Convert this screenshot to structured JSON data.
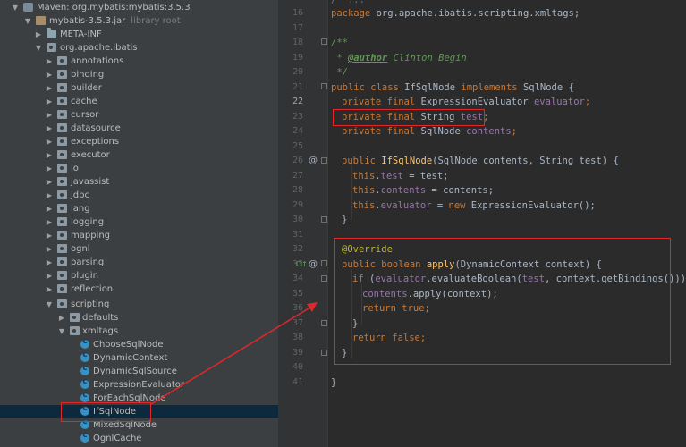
{
  "project_tree": {
    "maven_root": "Maven: org.mybatis:mybatis:3.5.3",
    "jar": {
      "name": "mybatis-3.5.3.jar",
      "suffix": "library root"
    },
    "meta_inf": "META-INF",
    "base_package": "org.apache.ibatis",
    "packages": [
      "annotations",
      "binding",
      "builder",
      "cache",
      "cursor",
      "datasource",
      "exceptions",
      "executor",
      "io",
      "javassist",
      "jdbc",
      "lang",
      "logging",
      "mapping",
      "ognl",
      "parsing",
      "plugin",
      "reflection"
    ],
    "scripting": "scripting",
    "defaults": "defaults",
    "xmltags": "xmltags",
    "classes": [
      "ChooseSqlNode",
      "DynamicContext",
      "DynamicSqlSource",
      "ExpressionEvaluator",
      "ForEachSqlNode",
      "IfSqlNode",
      "MixedSqlNode",
      "OgnlCache"
    ],
    "selected": "IfSqlNode"
  },
  "editor": {
    "line_numbers": [
      "16",
      "17",
      "18",
      "19",
      "20",
      "21",
      "22",
      "23",
      "24",
      "25",
      "26",
      "27",
      "28",
      "29",
      "30",
      "31",
      "32",
      "33",
      "34",
      "35",
      "36",
      "37",
      "38",
      "39",
      "40",
      "41"
    ],
    "gutter_marks": {
      "at_26": "@",
      "at_33": "@",
      "override_33": "O↑"
    },
    "code": {
      "l16_kw": "package",
      "l16_rest": " org.apache.ibatis.scripting.xmltags;",
      "l19": "/**",
      "l20_star": " * ",
      "l20_tag": "@author",
      "l20_name": " Clinton Begin",
      "l21": " */",
      "l21b_kw": "public class",
      "l21b_name": " IfSqlNode ",
      "l21b_kw2": "implements",
      "l21b_rest": " SqlNode {",
      "l22_kw": "private final",
      "l22_type": " ExpressionEvaluator ",
      "l22_field": "evaluator",
      "l22_end": ";",
      "l23_kw": "private final",
      "l23_type": " String ",
      "l23_field": "test",
      "l23_end": ";",
      "l24_kw": "private final",
      "l24_type": " SqlNode ",
      "l24_field": "contents",
      "l24_end": ";",
      "l26_kw": "public",
      "l26_fn": " IfSqlNode",
      "l26_rest": "(SqlNode contents, String test) {",
      "l27_kw": "this",
      "l27_dot": ".",
      "l27_field": "test",
      "l27_rest": " = test;",
      "l28_kw": "this",
      "l28_dot": ".",
      "l28_field": "contents",
      "l28_rest": " = contents;",
      "l29_kw": "this",
      "l29_dot": ".",
      "l29_field": "evaluator",
      "l29_mid": " = ",
      "l29_kw2": "new",
      "l29_rest": " ExpressionEvaluator();",
      "l30": "}",
      "l32": "@Override",
      "l33_kw": "public boolean",
      "l33_fn": " apply",
      "l33_rest": "(DynamicContext context) {",
      "l34_kw": "if",
      "l34_a": " (",
      "l34_field": "evaluator",
      "l34_b": ".evaluateBoolean(",
      "l34_field2": "test",
      "l34_c": ", context.getBindings())) {",
      "l35_field": "contents",
      "l35_rest": ".apply(context);",
      "l36_kw": "return",
      "l36_kw2": " true",
      "l36_end": ";",
      "l37": "}",
      "l38_kw": "return",
      "l38_kw2": " false",
      "l38_end": ";",
      "l39": "}",
      "l41": "}",
      "top_fold": "/**..."
    }
  },
  "colors": {
    "highlight_box": "#e0272b",
    "keyword": "#cc7832",
    "field": "#9876aa",
    "annotation": "#bbb529",
    "selection": "#0d293e"
  }
}
